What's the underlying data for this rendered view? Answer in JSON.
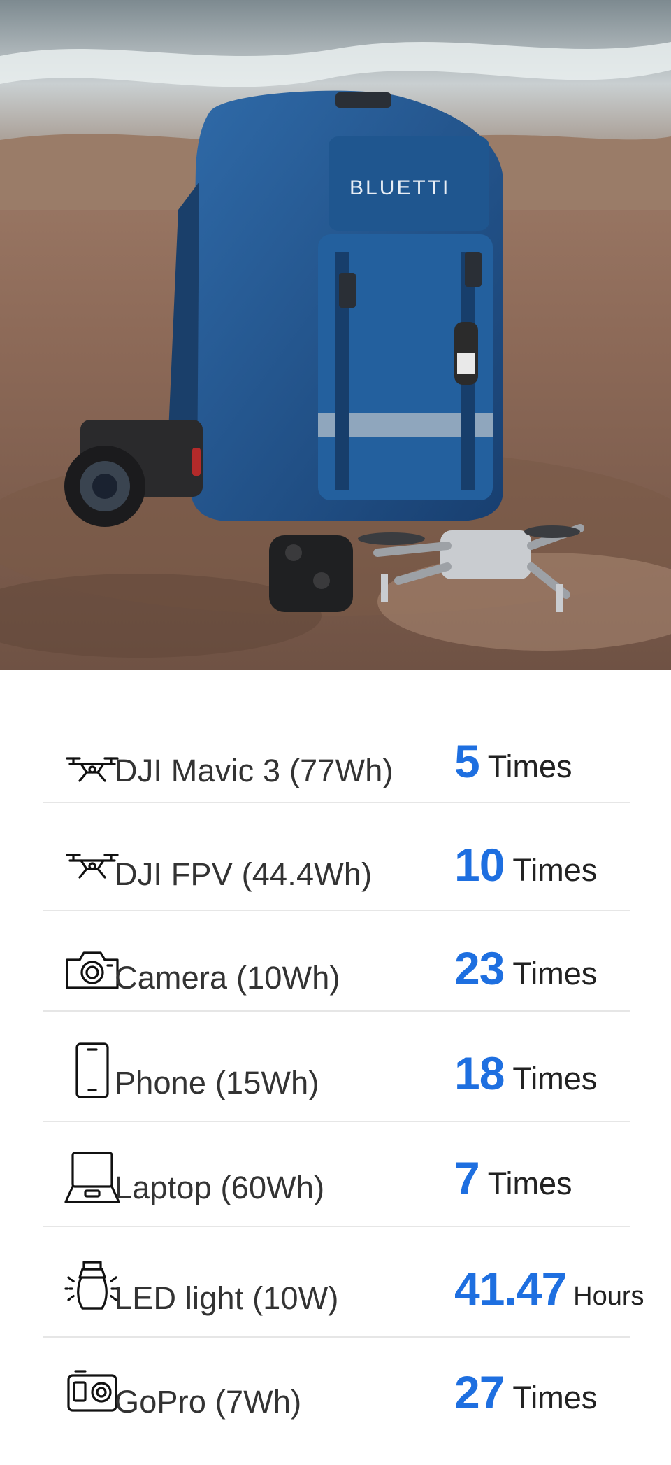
{
  "hero": {
    "image": "backpack-on-rock-photo",
    "brand_text": "BLUETTI"
  },
  "colors": {
    "accent": "#1e6fe0",
    "label": "#333333",
    "divider": "#e6e6e6"
  },
  "rows": [
    {
      "icon": "drone-icon",
      "label": "DJI Mavic 3 (77Wh)",
      "value": "5",
      "unit": "Times"
    },
    {
      "icon": "drone-icon",
      "label": "DJI FPV (44.4Wh)",
      "value": "10",
      "unit": "Times"
    },
    {
      "icon": "camera-icon",
      "label": "Camera (10Wh)",
      "value": "23",
      "unit": "Times"
    },
    {
      "icon": "phone-icon",
      "label": "Phone (15Wh)",
      "value": "18",
      "unit": "Times"
    },
    {
      "icon": "laptop-icon",
      "label": "Laptop (60Wh)",
      "value": "7",
      "unit": "Times"
    },
    {
      "icon": "lantern-icon",
      "label": "LED light (10W)",
      "value": "41.47",
      "unit": "Hours"
    },
    {
      "icon": "gopro-icon",
      "label": "GoPro (7Wh)",
      "value": "27",
      "unit": "Times"
    }
  ]
}
